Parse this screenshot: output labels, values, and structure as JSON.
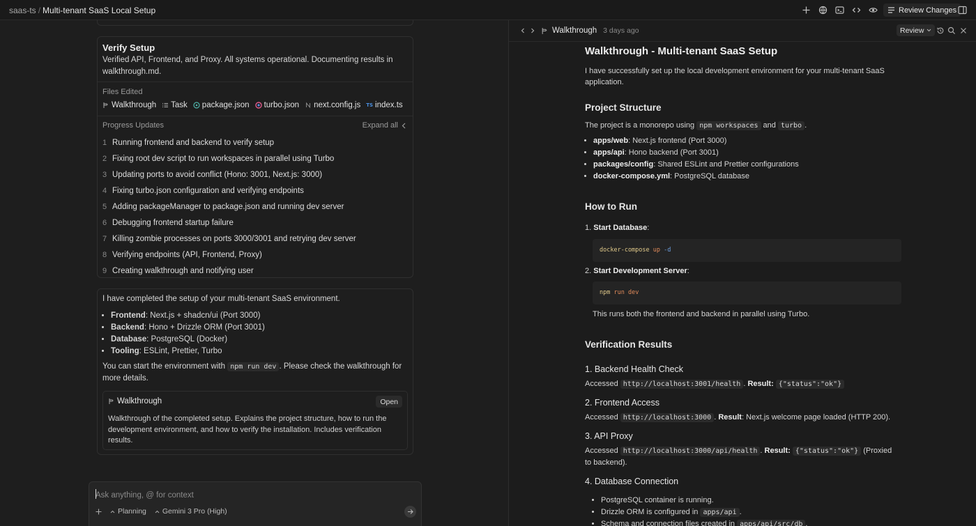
{
  "topbar": {
    "project": "saas-ts",
    "separator": "/",
    "title": "Multi-tenant SaaS Local Setup",
    "review_changes_label": "Review Changes",
    "icons": [
      "plus-icon",
      "globe-icon",
      "terminal-icon",
      "code-icon",
      "eye-icon",
      "review-icon",
      "panel-toggle-icon"
    ]
  },
  "verify": {
    "title": "Verify Setup",
    "description": "Verified API, Frontend, and Proxy. All systems operational. Documenting results in walkthrough.md.",
    "files_edited_label": "Files Edited",
    "files": [
      {
        "name": "Walkthrough",
        "icon": "walkthrough-icon"
      },
      {
        "name": "Task",
        "icon": "task-icon"
      },
      {
        "name": "package.json",
        "icon": "json-icon"
      },
      {
        "name": "turbo.json",
        "icon": "turbo-icon"
      },
      {
        "name": "next.config.js",
        "icon": "nextjs-icon"
      },
      {
        "name": "index.ts",
        "icon": "typescript-icon"
      }
    ],
    "progress_label": "Progress Updates",
    "expand_all_label": "Expand all",
    "steps": [
      {
        "num": "1",
        "text": "Running frontend and backend to verify setup"
      },
      {
        "num": "2",
        "text": "Fixing root dev script to run workspaces in parallel using Turbo"
      },
      {
        "num": "3",
        "text": "Updating ports to avoid conflict (Hono: 3001, Next.js: 3000)"
      },
      {
        "num": "4",
        "text": "Fixing turbo.json configuration and verifying endpoints"
      },
      {
        "num": "5",
        "text": "Adding packageManager to package.json and running dev server"
      },
      {
        "num": "6",
        "text": "Debugging frontend startup failure"
      },
      {
        "num": "7",
        "text": "Killing zombie processes on ports 3000/3001 and retrying dev server"
      },
      {
        "num": "8",
        "text": "Verifying endpoints (API, Frontend, Proxy)"
      },
      {
        "num": "9",
        "text": "Creating walkthrough and notifying user"
      }
    ]
  },
  "summary": {
    "intro": "I have completed the setup of your multi-tenant SaaS environment.",
    "items": [
      {
        "label": "Frontend",
        "text": ": Next.js + shadcn/ui (Port 3000)"
      },
      {
        "label": "Backend",
        "text": ": Hono + Drizzle ORM (Port 3001)"
      },
      {
        "label": "Database",
        "text": ": PostgreSQL (Docker)"
      },
      {
        "label": "Tooling",
        "text": ": ESLint, Prettier, Turbo"
      }
    ],
    "start_pre": "You can start the environment with ",
    "start_code": "npm run dev",
    "start_post": ". Please check the walkthrough for more details.",
    "card_title": "Walkthrough",
    "card_open": "Open",
    "card_desc": "Walkthrough of the completed setup. Explains the project structure, how to run the development environment, and how to verify the installation. Includes verification results."
  },
  "input": {
    "placeholder": "Ask anything, @ for context",
    "mode": "Planning",
    "model": "Gemini 3 Pro (High)"
  },
  "right": {
    "tab_title": "Walkthrough",
    "tab_ago": "3 days ago",
    "review_label": "Review"
  },
  "doc": {
    "title": "Walkthrough - Multi-tenant SaaS Setup",
    "intro": "I have successfully set up the local development environment for your multi-tenant SaaS application.",
    "structure_heading": "Project Structure",
    "structure_pre": "The project is a monorepo using ",
    "structure_code1": "npm workspaces",
    "structure_and": " and ",
    "structure_code2": "turbo",
    "structure_post": ".",
    "structure_items": [
      {
        "label": "apps/web",
        "text": ": Next.js frontend (Port 3000)"
      },
      {
        "label": "apps/api",
        "text": ": Hono backend (Port 3001)"
      },
      {
        "label": "packages/config",
        "text": ": Shared ESLint and Prettier configurations"
      },
      {
        "label": "docker-compose.yml",
        "text": ": PostgreSQL database"
      }
    ],
    "run_heading": "How to Run",
    "run_step1_num": "1.",
    "run_step1": "Start Database",
    "run_code1_cmd": "docker-compose",
    "run_code1_arg": "up",
    "run_code1_flag": "-d",
    "run_step2_num": "2.",
    "run_step2": "Start Development Server",
    "run_code2_cmd": "npm",
    "run_code2_arg": "run dev",
    "run_note": "This runs both the frontend and backend in parallel using Turbo.",
    "verify_heading": "Verification Results",
    "checks": [
      {
        "title": "1. Backend Health Check",
        "pre": "Accessed ",
        "url": "http://localhost:3001/health",
        "result_label": "Result:",
        "result_code": "{\"status\":\"ok\"}",
        "post": ""
      },
      {
        "title": "2. Frontend Access",
        "pre": "Accessed ",
        "url": "http://localhost:3000",
        "result_label": "Result",
        "result_code": "",
        "post": ": Next.js welcome page loaded (HTTP 200)."
      },
      {
        "title": "3. API Proxy",
        "pre": "Accessed ",
        "url": "http://localhost:3000/api/health",
        "result_label": "Result:",
        "result_code": "{\"status\":\"ok\"}",
        "post": " (Proxied to backend)."
      }
    ],
    "db_heading": "4. Database Connection",
    "db_items": [
      {
        "text": "PostgreSQL container is running.",
        "code": ""
      },
      {
        "text": "Drizzle ORM is configured in ",
        "code": "apps/api",
        "post": "."
      },
      {
        "text": "Schema and connection files created in ",
        "code": "apps/api/src/db",
        "post": "."
      }
    ]
  }
}
